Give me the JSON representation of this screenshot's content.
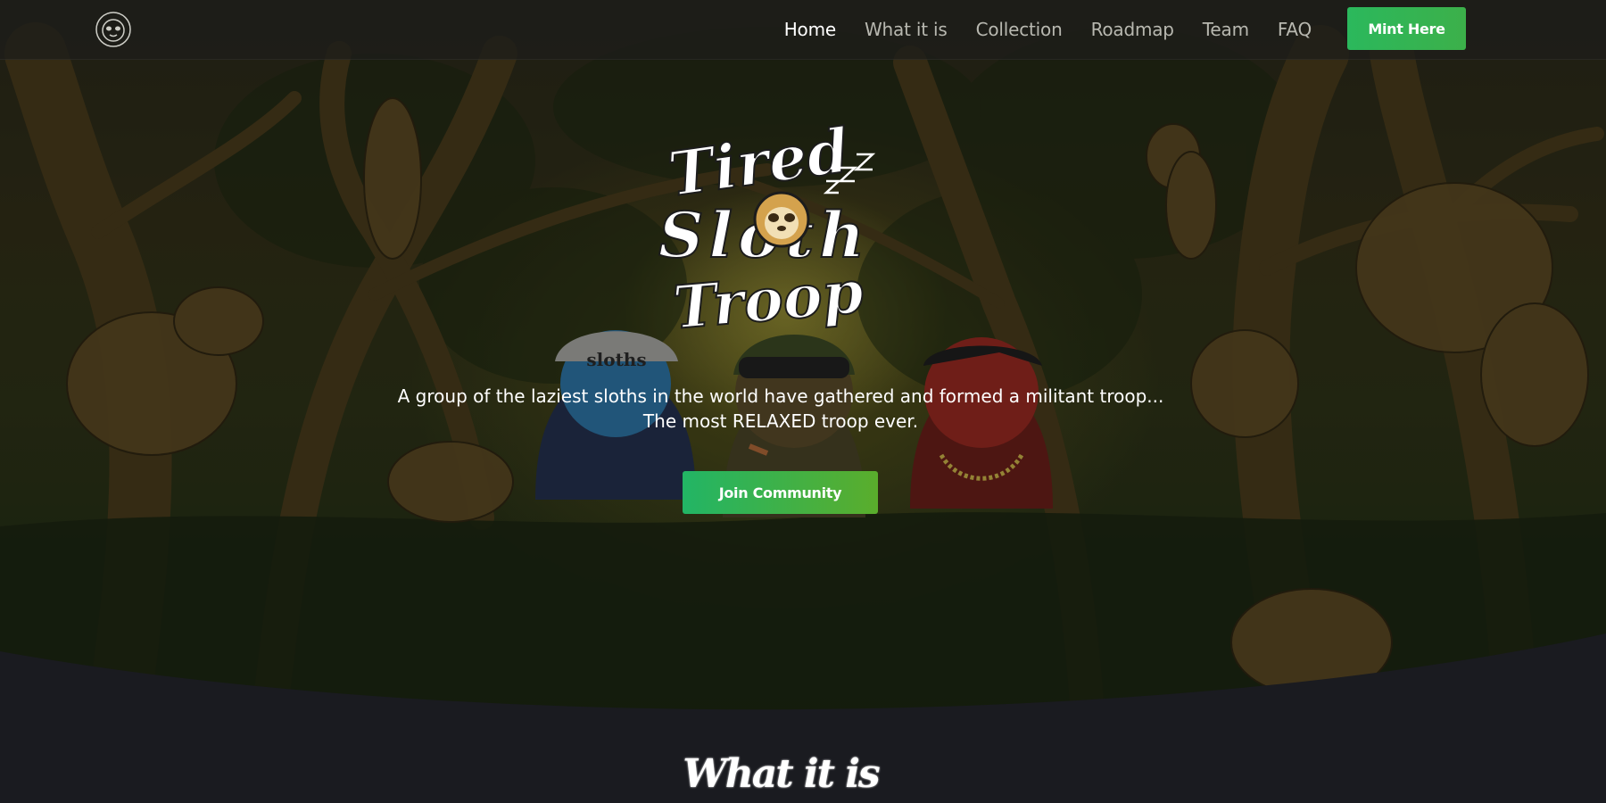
{
  "nav": {
    "links": [
      {
        "label": "Home",
        "active": true
      },
      {
        "label": "What it is",
        "active": false
      },
      {
        "label": "Collection",
        "active": false
      },
      {
        "label": "Roadmap",
        "active": false
      },
      {
        "label": "Team",
        "active": false
      },
      {
        "label": "FAQ",
        "active": false
      }
    ],
    "cta_label": "Mint Here"
  },
  "hero": {
    "logo_lines": [
      "Tired",
      "Sloth",
      "Troop"
    ],
    "beanie_text": "sloths",
    "tagline_line1": "A group of the laziest sloths in the world have gathered and formed a militant troop...",
    "tagline_line2": "The most RELAXED troop ever.",
    "join_label": "Join Community"
  },
  "section": {
    "title": "What it is"
  },
  "colors": {
    "accent_green": "#2bb85c",
    "background_dark": "#1a1b20",
    "silhouette": "#5e4b24"
  }
}
